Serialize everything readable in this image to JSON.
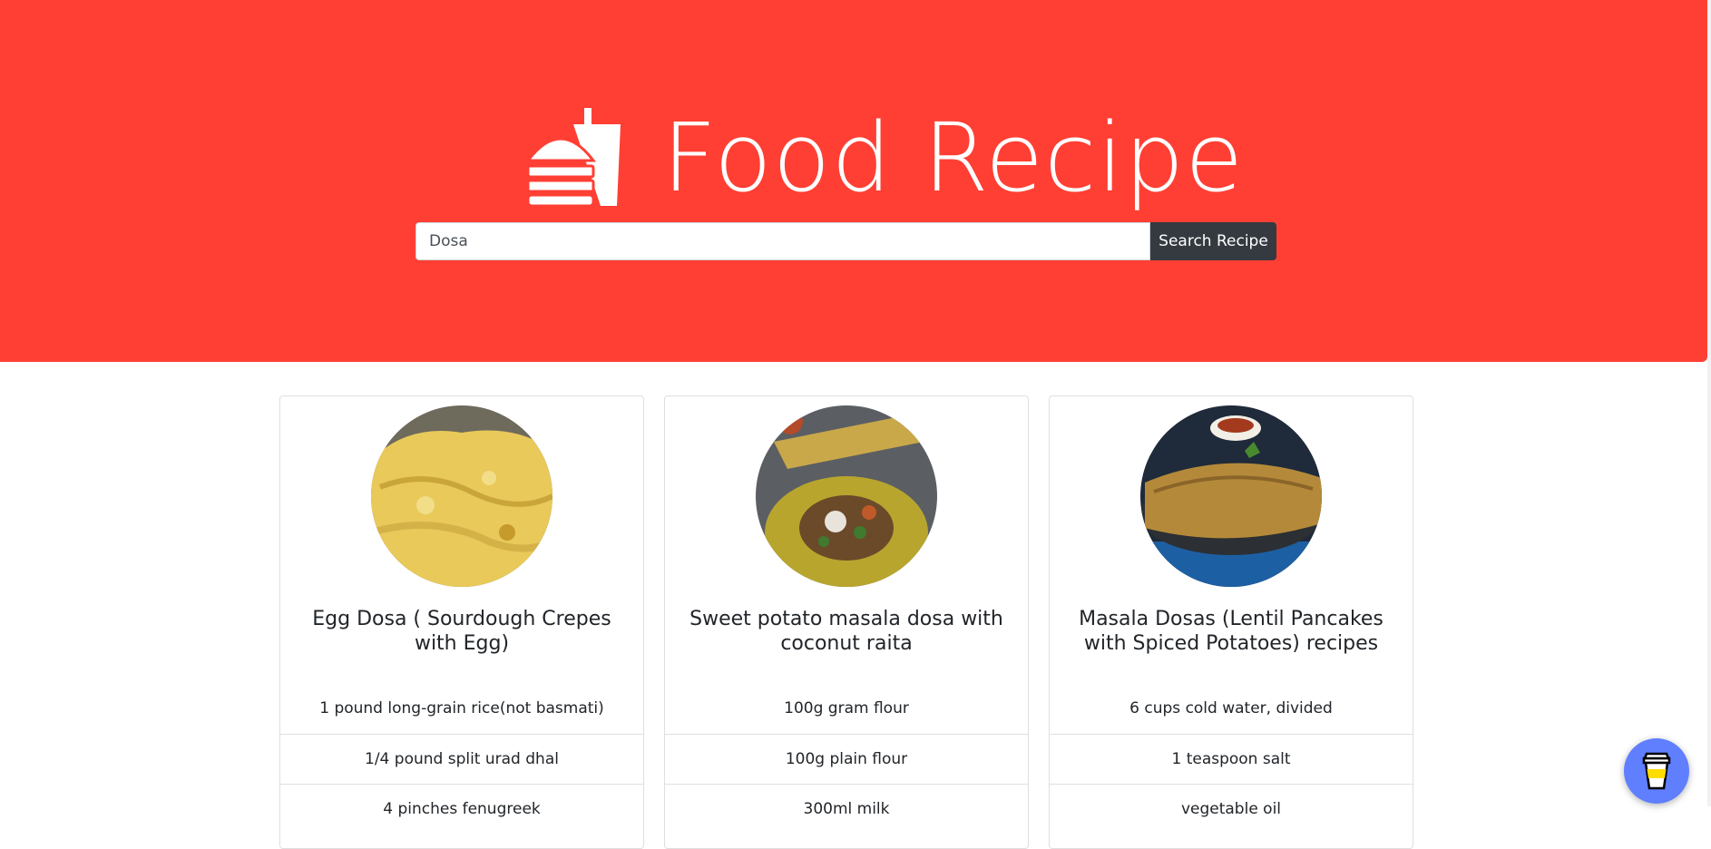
{
  "header": {
    "title": "Food Recipe",
    "logo_icon": "burger-drink-icon"
  },
  "search": {
    "value": "Dosa",
    "placeholder": "Dosa",
    "button_label": "Search Recipe"
  },
  "recipes": [
    {
      "title": "Egg Dosa ( Sourdough Crepes with Egg)",
      "ingredients": [
        "1 pound long-grain rice(not basmati)",
        "1/4 pound split urad dhal",
        "4 pinches fenugreek"
      ]
    },
    {
      "title": "Sweet potato masala dosa with coconut raita",
      "ingredients": [
        "100g gram flour",
        "100g plain flour",
        "300ml milk"
      ]
    },
    {
      "title": "Masala Dosas (Lentil Pancakes with Spiced Potatoes) recipes",
      "ingredients": [
        "6 cups cold water, divided",
        "1 teaspoon salt",
        "vegetable oil"
      ]
    }
  ],
  "colors": {
    "hero": "#ff3f34",
    "button": "#343a40",
    "coffee_button": "#5f7fff"
  },
  "floating_button_icon": "coffee-cup-icon"
}
